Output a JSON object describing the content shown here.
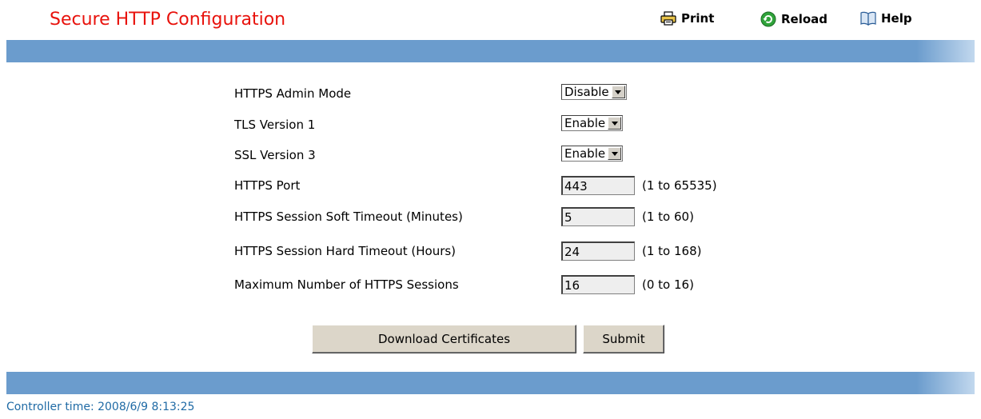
{
  "page": {
    "title": "Secure HTTP Configuration"
  },
  "toolbar": {
    "print_label": "Print",
    "reload_label": "Reload",
    "help_label": "Help"
  },
  "form": {
    "admin_mode": {
      "label": "HTTPS Admin Mode",
      "value": "Disable"
    },
    "tls_v1": {
      "label": "TLS Version 1",
      "value": "Enable"
    },
    "ssl_v3": {
      "label": "SSL Version 3",
      "value": "Enable"
    },
    "port": {
      "label": "HTTPS Port",
      "value": "443",
      "range": "(1 to 65535)"
    },
    "soft_timeout": {
      "label": "HTTPS Session Soft Timeout (Minutes)",
      "value": "5",
      "range": "(1 to 60)"
    },
    "hard_timeout": {
      "label": "HTTPS Session Hard Timeout (Hours)",
      "value": "24",
      "range": "(1 to 168)"
    },
    "max_sessions": {
      "label": "Maximum Number of HTTPS Sessions",
      "value": "16",
      "range": "(0 to 16)"
    }
  },
  "buttons": {
    "download_label": "Download Certificates",
    "submit_label": "Submit"
  },
  "footer": {
    "controller_time": "Controller time: 2008/6/9 8:13:25"
  },
  "colors": {
    "title": "#e8120c",
    "bar": "#6b9ccd",
    "footer_text": "#1f6aa5",
    "button": "#dcd6c9"
  }
}
